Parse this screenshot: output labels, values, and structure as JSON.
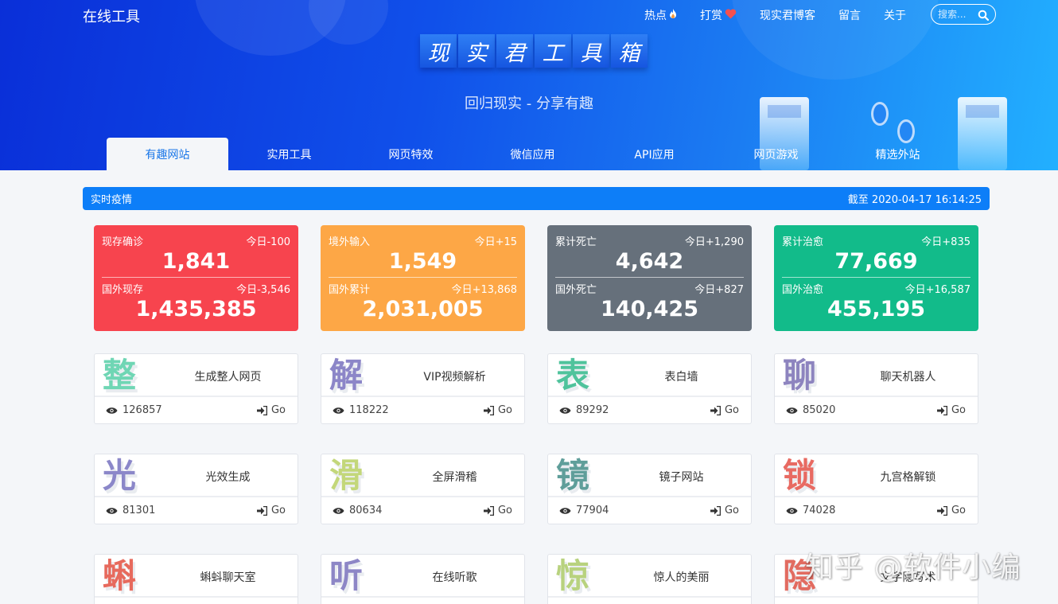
{
  "header": {
    "site_title": "在线工具",
    "nav": [
      {
        "label": "热点",
        "icon": "fire-icon"
      },
      {
        "label": "打赏",
        "icon": "heart-icon"
      },
      {
        "label": "现实君博客"
      },
      {
        "label": "留言"
      },
      {
        "label": "关于"
      }
    ],
    "search_placeholder": "搜索...",
    "banner_chars": [
      "现",
      "实",
      "君",
      "工",
      "具",
      "箱"
    ],
    "slogan": "回归现实 - 分享有趣",
    "tabs": [
      "有趣网站",
      "实用工具",
      "网页特效",
      "微信应用",
      "API应用",
      "网页游戏",
      "精选外站"
    ]
  },
  "notice": {
    "title": "实时疫情",
    "timestamp": "截至 2020-04-17 16:14:25"
  },
  "stats": [
    {
      "label1": "现存确诊",
      "delta1": "今日-100",
      "value1": "1,841",
      "label2": "国外现存",
      "delta2": "今日-3,546",
      "value2": "1,435,385"
    },
    {
      "label1": "境外输入",
      "delta1": "今日+15",
      "value1": "1,549",
      "label2": "国外累计",
      "delta2": "今日+13,868",
      "value2": "2,031,005"
    },
    {
      "label1": "累计死亡",
      "delta1": "今日+1,290",
      "value1": "4,642",
      "label2": "国外死亡",
      "delta2": "今日+827",
      "value2": "140,425"
    },
    {
      "label1": "累计治愈",
      "delta1": "今日+835",
      "value1": "77,669",
      "label2": "国外治愈",
      "delta2": "今日+16,587",
      "value2": "455,195"
    }
  ],
  "cards": [
    {
      "glyph": "整",
      "color": "#6fd6b4",
      "title": "生成整人网页",
      "views": "126857",
      "go": "Go"
    },
    {
      "glyph": "解",
      "color": "#8c86c8",
      "title": "VIP视频解析",
      "views": "118222",
      "go": "Go"
    },
    {
      "glyph": "表",
      "color": "#4fc39c",
      "title": "表白墙",
      "views": "89292",
      "go": "Go"
    },
    {
      "glyph": "聊",
      "color": "#8d84bf",
      "title": "聊天机器人",
      "views": "85020",
      "go": "Go"
    },
    {
      "glyph": "光",
      "color": "#8b87c9",
      "title": "光效生成",
      "views": "81301",
      "go": "Go"
    },
    {
      "glyph": "滑",
      "color": "#c3d77a",
      "title": "全屏滑稽",
      "views": "80634",
      "go": "Go"
    },
    {
      "glyph": "镜",
      "color": "#5f9e9a",
      "title": "镜子网站",
      "views": "77904",
      "go": "Go"
    },
    {
      "glyph": "锁",
      "color": "#e86a62",
      "title": "九宫格解锁",
      "views": "74028",
      "go": "Go"
    },
    {
      "glyph": "蝌",
      "color": "#e76a5d",
      "title": "蝌蚪聊天室",
      "views": "",
      "go": ""
    },
    {
      "glyph": "听",
      "color": "#8d86c6",
      "title": "在线听歌",
      "views": "",
      "go": ""
    },
    {
      "glyph": "惊",
      "color": "#b8d27e",
      "title": "惊人的美丽",
      "views": "",
      "go": ""
    },
    {
      "glyph": "隐",
      "color": "#e26b60",
      "title": "文字隐写术",
      "views": "",
      "go": ""
    }
  ],
  "watermark": "知乎 @软件小编"
}
